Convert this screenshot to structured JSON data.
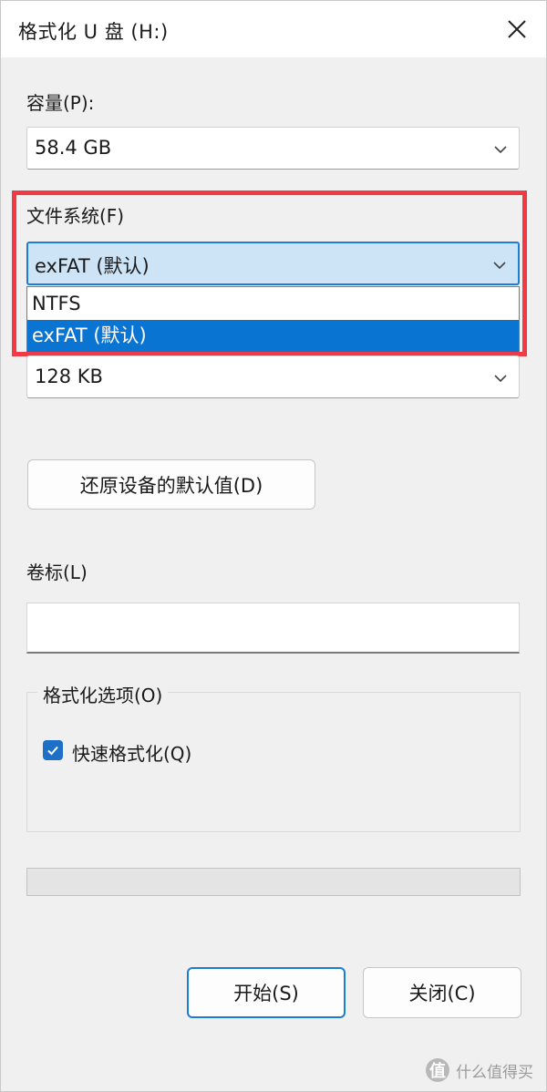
{
  "window": {
    "title": "格式化 U 盘 (H:)"
  },
  "capacity": {
    "label": "容量(P):",
    "value": "58.4 GB"
  },
  "filesystem": {
    "label": "文件系统(F)",
    "value": "exFAT (默认)",
    "options": [
      "NTFS",
      "exFAT (默认)"
    ],
    "selected_index": 1
  },
  "allocation": {
    "value": "128 KB"
  },
  "restore_button": {
    "label": "还原设备的默认值(D)"
  },
  "volume_label": {
    "label": "卷标(L)",
    "value": ""
  },
  "format_options": {
    "legend": "格式化选项(O)",
    "quick_format": {
      "label": "快速格式化(Q)",
      "checked": true
    }
  },
  "progress": {
    "value": 0
  },
  "buttons": {
    "start": "开始(S)",
    "close": "关闭(C)"
  },
  "watermark": {
    "logo_char": "值",
    "text": "什么值得买"
  },
  "colors": {
    "accent": "#0a74d3",
    "highlight_box": "#f23a47",
    "checkbox": "#1e6fc8"
  }
}
